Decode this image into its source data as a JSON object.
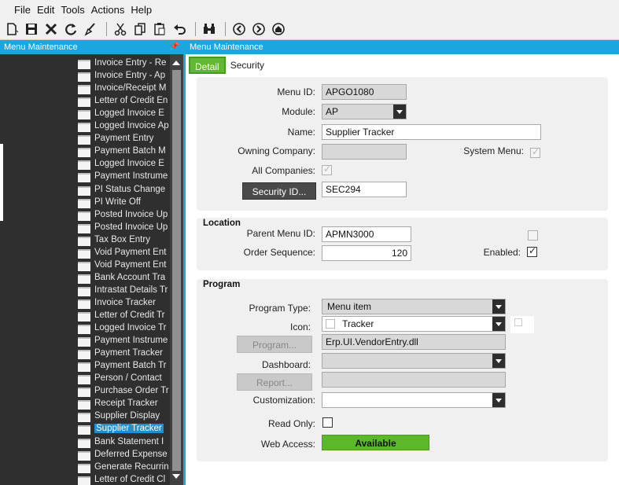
{
  "menubar": {
    "items": [
      "File",
      "Edit",
      "Tools",
      "Actions",
      "Help"
    ]
  },
  "toolbar": {
    "icons": [
      "new-icon",
      "save-icon",
      "delete-icon",
      "refresh-icon",
      "clear-icon",
      "cut-icon",
      "copy-icon",
      "paste-icon",
      "undo-icon",
      "find-icon",
      "back-icon",
      "forward-icon",
      "home-icon"
    ]
  },
  "left_panel": {
    "title": "Menu Maintenance",
    "items": [
      "Invoice Entry - Re",
      "Invoice Entry - Ap",
      "Invoice/Receipt M",
      "Letter of Credit En",
      "Logged Invoice E",
      "Logged Invoice Ap",
      "Payment Entry",
      "Payment Batch M",
      "Logged Invoice E",
      "Payment Instrume",
      "PI Status Change",
      "PI Write Off",
      "Posted Invoice Up",
      "Posted Invoice Up",
      "Tax Box Entry",
      "Void Payment Ent",
      "Void Payment Ent",
      "Bank Account Tra",
      "Intrastat Details Tr",
      "Invoice Tracker",
      "Letter of Credit Tr",
      "Logged Invoice Tr",
      "Payment Instrume",
      "Payment Tracker",
      "Payment Batch Tr",
      "Person / Contact",
      "Purchase Order Tr",
      "Receipt Tracker",
      "Supplier Display",
      "Supplier Tracker",
      "Bank Statement I",
      "Deferred Expense",
      "Generate Recurrin",
      "Letter of Credit Cl"
    ],
    "selected_index": 29
  },
  "right_panel": {
    "title": "Menu Maintenance",
    "tabs": [
      "Detail",
      "Security"
    ],
    "detail": {
      "menu_id_label": "Menu ID:",
      "menu_id": "APGO1080",
      "module_label": "Module:",
      "module": "AP",
      "name_label": "Name:",
      "name": "Supplier Tracker",
      "owning_company_label": "Owning Company:",
      "owning_company": "",
      "system_menu_label": "System Menu:",
      "all_companies_label": "All Companies:",
      "security_id_button": "Security ID...",
      "security_id": "SEC294"
    },
    "location": {
      "title": "Location",
      "parent_menu_id_label": "Parent Menu ID:",
      "parent_menu_id": "APMN3000",
      "order_sequence_label": "Order Sequence:",
      "order_sequence": "120",
      "enabled_label": "Enabled:"
    },
    "program": {
      "title": "Program",
      "program_type_label": "Program Type:",
      "program_type": "Menu item",
      "icon_label": "Icon:",
      "icon_value": "Tracker",
      "program_button": "Program...",
      "program_value": "Erp.UI.VendorEntry.dll",
      "dashboard_label": "Dashboard:",
      "dashboard_value": "",
      "report_button": "Report...",
      "report_value": "",
      "customization_label": "Customization:",
      "customization_value": "",
      "read_only_label": "Read Only:",
      "web_access_label": "Web Access:",
      "web_access_value": "Available"
    }
  },
  "colors": {
    "accent": "#1ba6e0",
    "tab_active": "#61b832",
    "available": "#5cb82a"
  }
}
